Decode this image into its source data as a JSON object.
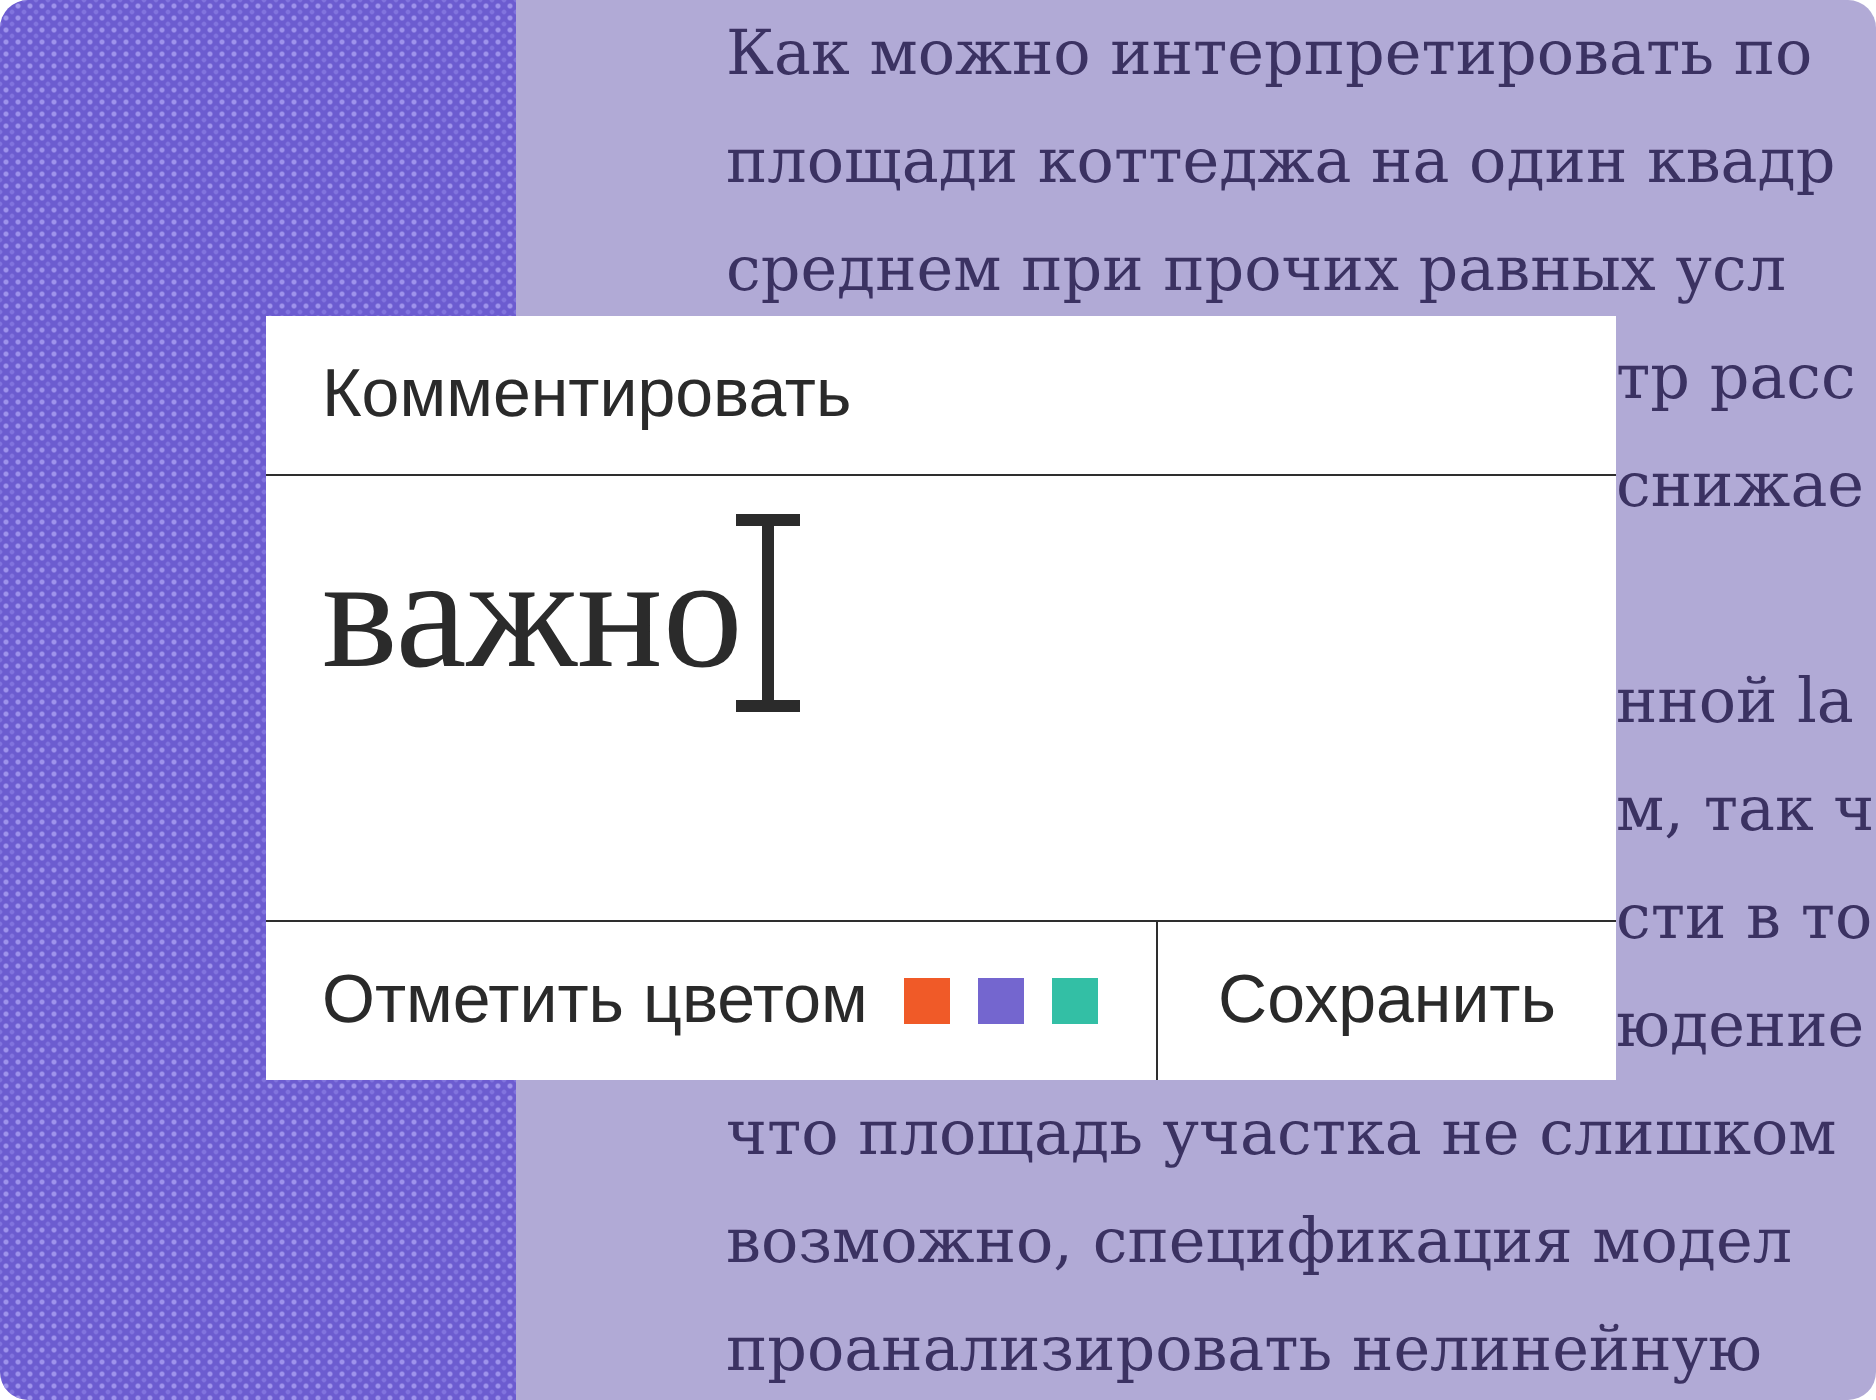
{
  "article": {
    "lines_above": [
      "Как можно интерпретировать по",
      "площади коттеджа на один квадр",
      "среднем при прочих равных усл"
    ],
    "beside_card": [
      [
        "тр расс",
        "снижае"
      ],
      [
        "нной la",
        "м, так ч",
        "сти в то",
        "юдение"
      ]
    ],
    "lines_below": [
      "что площадь участка не слишком",
      "возможно, спецификация модел",
      "проанализировать нелинейную"
    ]
  },
  "comment_box": {
    "title": "Комментировать",
    "value": "важно",
    "color_label": "Отметить цветом",
    "color_swatches": [
      {
        "color": "#f05a28"
      },
      {
        "color": "#7466cf"
      },
      {
        "color": "#33bfa5"
      }
    ],
    "save_button": "Сохранить"
  }
}
